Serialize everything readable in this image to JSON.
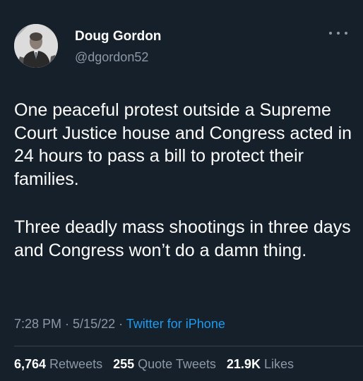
{
  "author": {
    "name": "Doug Gordon",
    "handle": "@dgordon52"
  },
  "tweet": {
    "paragraphs": [
      "One peaceful protest outside a Supreme Court Justice house and Congress acted in 24 hours to pass a bill to protect their families.",
      "Three deadly mass shootings in three days and Congress won’t do a damn thing."
    ]
  },
  "meta": {
    "time": "7:28 PM",
    "separator": " · ",
    "date": "5/15/22",
    "source": "Twitter for iPhone"
  },
  "stats": {
    "retweets_count": "6,764",
    "retweets_label": "Retweets",
    "quotes_count": "255",
    "quotes_label": "Quote Tweets",
    "likes_count": "21.9K",
    "likes_label": "Likes"
  },
  "colors": {
    "background": "#15202b",
    "secondary_text": "#8b98a5",
    "link": "#1d9bf0"
  },
  "icons": {
    "more": "more-horizontal-icon"
  }
}
